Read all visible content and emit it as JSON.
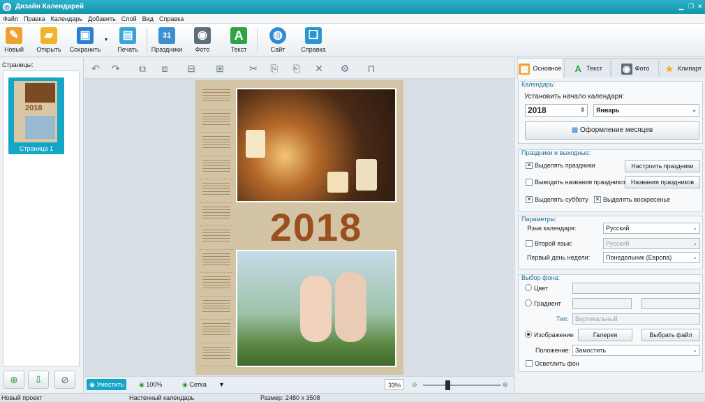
{
  "window": {
    "title": "Дизайн Календарей"
  },
  "menu": [
    "Файл",
    "Правка",
    "Календарь",
    "Добавить",
    "Слой",
    "Вид",
    "Справка"
  ],
  "toolbar": {
    "new": "Новый",
    "open": "Открыть",
    "save": "Сохранить",
    "print": "Печать",
    "holidays": "Праздники",
    "photo": "Фото",
    "text": "Текст",
    "site": "Сайт",
    "help": "Справка"
  },
  "left": {
    "pages_label": "Страницы:",
    "thumb_caption": "Страница 1",
    "thumb_year": "2018"
  },
  "canvas": {
    "year": "2018"
  },
  "bottombar": {
    "fit": "Уместить",
    "zoom100": "100%",
    "grid": "Сетка",
    "zoom": "33%",
    "zoom_level": 0.3
  },
  "status": {
    "project": "Новый проект",
    "type": "Настенный календарь",
    "size": "Размер: 2480 x 3508"
  },
  "tabs": [
    "Основное",
    "Текст",
    "Фото",
    "Клипарт"
  ],
  "calendar": {
    "group": "Календарь:",
    "start_label": "Установить начало календаря:",
    "year": "2018",
    "month": "Январь",
    "months_btn": "Оформление месяцев"
  },
  "holidays": {
    "group": "Праздники и выходные:",
    "highlight": "Выделять праздники",
    "show_names": "Выводить названия праздников",
    "saturday": "Выделять субботу",
    "sunday": "Выделять воскресенье",
    "setup_btn": "Настроить праздники",
    "names_btn": "Названия праздников"
  },
  "params": {
    "group": "Параметры:",
    "lang_label": "Язык календаря:",
    "lang": "Русский",
    "second_label": "Второй язык:",
    "second": "Русский",
    "week_label": "Первый день недели:",
    "week": "Понедельник (Европа)"
  },
  "bg": {
    "group": "Выбор фона:",
    "color": "Цвет",
    "gradient": "Градиент",
    "type_label": "Тип:",
    "type": "Вертикальный",
    "image": "Изображение",
    "gallery": "Галерея",
    "choose": "Выбрать файл",
    "pos_label": "Положение:",
    "pos": "Замостить",
    "lighten": "Осветлить фон"
  }
}
